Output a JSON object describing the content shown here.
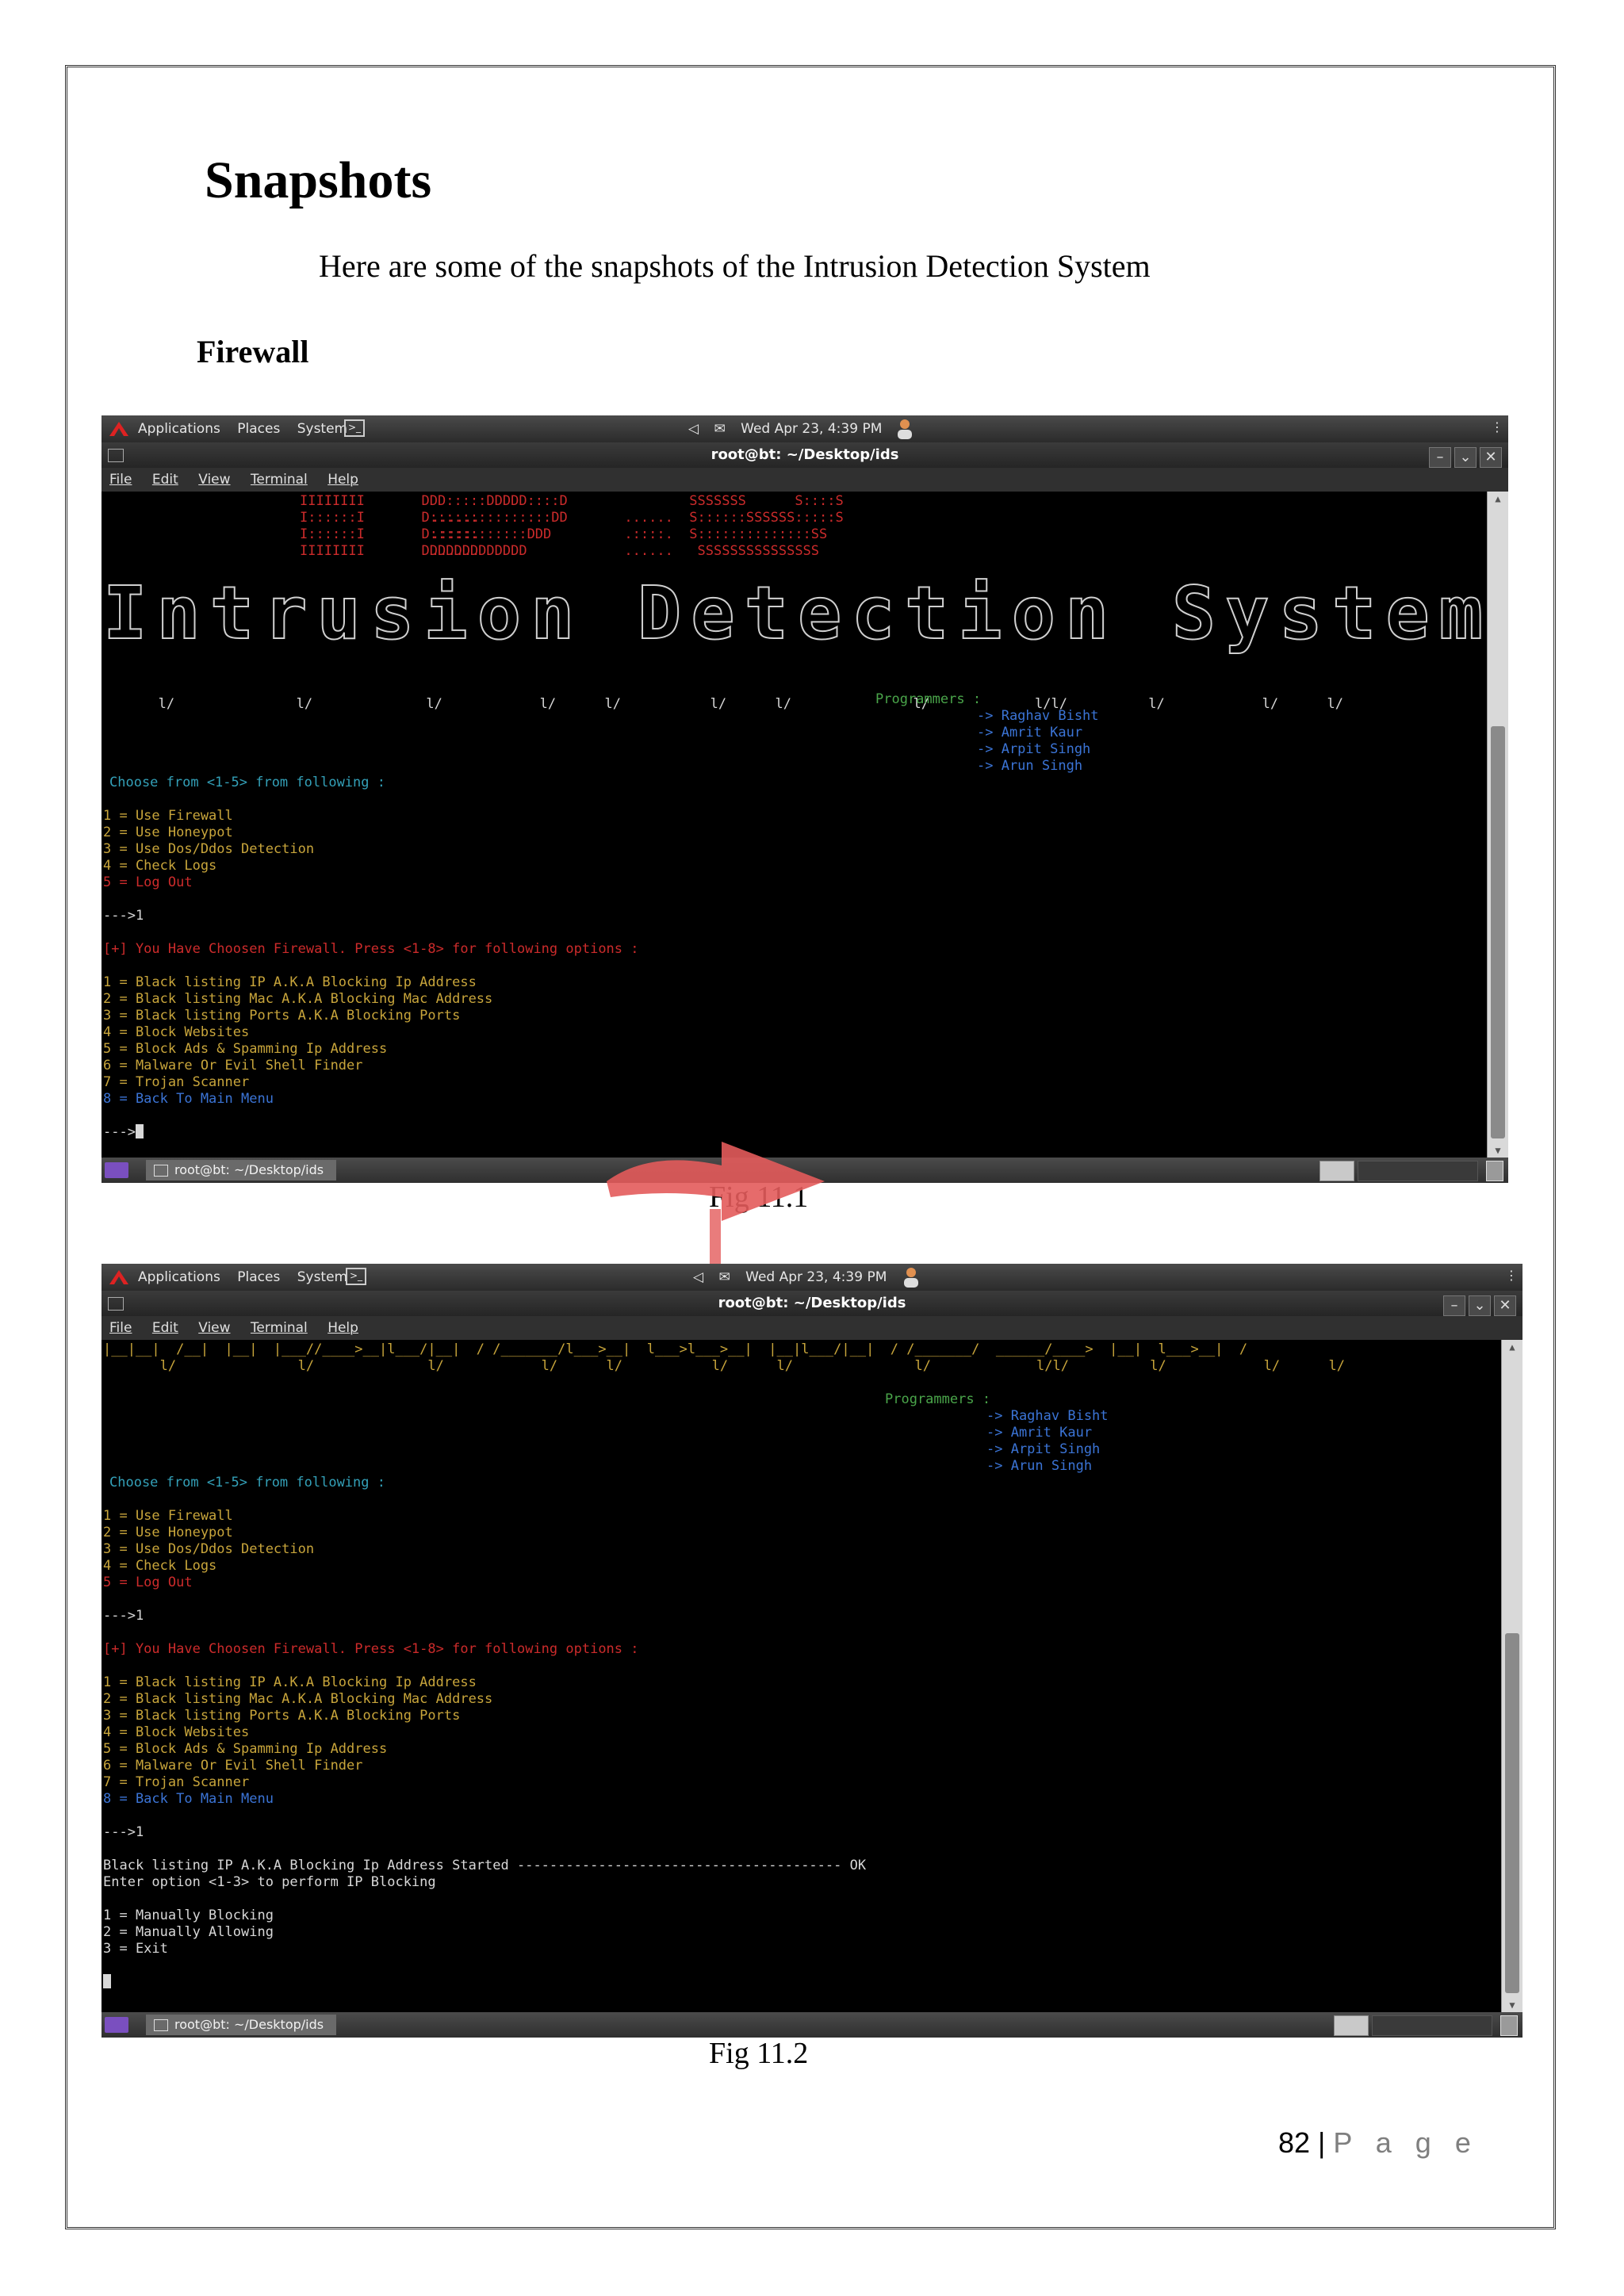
{
  "document": {
    "heading": "Snapshots",
    "intro": "Here are some of the snapshots of the Intrusion Detection System",
    "section": "Firewall",
    "fig1_caption": "Fig 11.1",
    "fig2_caption": "Fig 11.2",
    "footer": {
      "page_number": "82",
      "separator": "|",
      "page_word": "P a g e"
    }
  },
  "desktop": {
    "menu": [
      "Applications",
      "Places",
      "System"
    ],
    "clock": "Wed Apr 23,  4:39 PM",
    "window_title": "root@bt: ~/Desktop/ids",
    "menubar": [
      "File",
      "Edit",
      "View",
      "Terminal",
      "Help"
    ],
    "taskbar_item": "root@bt: ~/Desktop/ids"
  },
  "terminal": {
    "banner_lines": [
      "IIIIIIII       DDD:::::DDDDD::::D               SSSSSSS      S::::S",
      "I::::::I       D:::::::::::::::DD       ......  S::::::SSSSSS:::::S",
      "I::::::I       D::::::::::::DDD         .::::.  S::::::::::::::SS",
      "IIIIIIII       DDDDDDDDDDDDD            ......   SSSSSSSSSSSSSSS"
    ],
    "banner_dots_left": [
      "......",
      ".::::.",
      "......"
    ],
    "big_title": "Intrusion Detection System",
    "ascii_bottom_a": "|__|__|  /__|  |__|  |___//____>__|l___/|__|  / /_______/l___>__|  l___>l___>__|  |__|l___/|__|  / /_______/  ______/____>  |__|  l___>__|  /",
    "ascii_bottom_b": "       l/               l/              l/            l/      l/           l/      l/               l/             l/l/          l/            l/      l/",
    "programmers_label": "Programmers :",
    "programmers": [
      "-> Raghav Bisht",
      "-> Amrit Kaur",
      "-> Arpit Singh",
      "-> Arun Singh"
    ],
    "choose_prompt": "Choose from <1-5> from following :",
    "main_menu": [
      "1 = Use Firewall",
      "2 = Use Honeypot",
      "3 = Use Dos/Ddos Detection",
      "4 = Check Logs",
      "5 = Log Out"
    ],
    "input_1": "--->1",
    "chosen_msg": "[+] You Have Choosen Firewall. Press <1-8> for following options :",
    "fw_menu": [
      "1 = Black listing IP A.K.A Blocking Ip Address",
      "2 = Black listing Mac A.K.A Blocking Mac Address",
      "3 = Black listing Ports A.K.A Blocking Ports",
      "4 = Block Websites",
      "5 = Block Ads & Spamming Ip Address",
      "6 = Malware Or Evil Shell Finder",
      "7 = Trojan Scanner",
      "8 = Back To Main Menu"
    ],
    "prompt_empty": "--->",
    "prompt_1": "--->1",
    "started_msg": "Black listing IP A.K.A Blocking Ip Address Started ---------------------------------------- OK",
    "enter_option": "Enter option <1-3> to perform IP Blocking",
    "ip_menu": [
      "1 = Manually Blocking",
      "2 = Manually Allowing",
      "3 = Exit"
    ]
  },
  "colors": {
    "terminal_bg": "#000000",
    "banner_red": "#cc2b2b",
    "menu_yellow": "#c8a53b",
    "prompt_cyan": "#33a0b8",
    "programmers_blue": "#3b74d6",
    "programmers_label_green": "#4aa54a"
  }
}
